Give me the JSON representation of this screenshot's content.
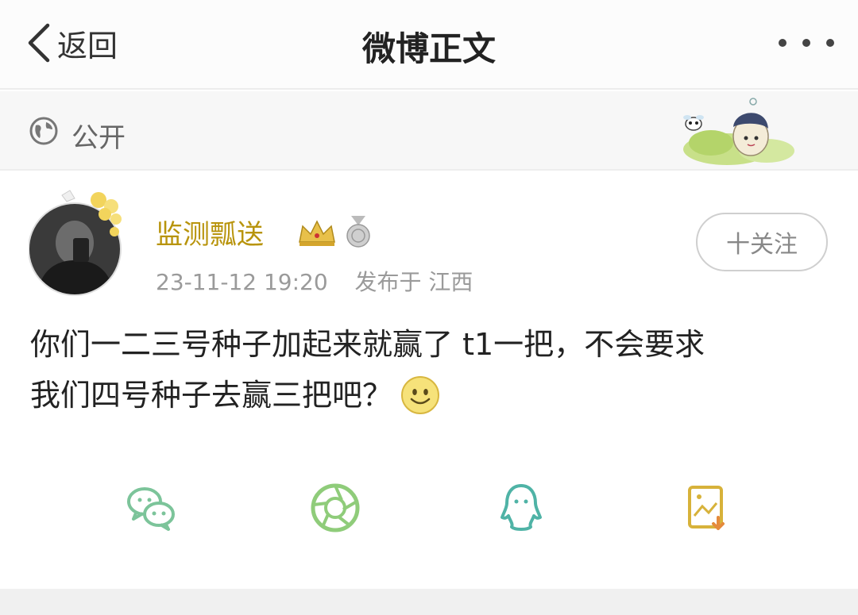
{
  "navbar": {
    "back_label": "返回",
    "title": "微博正文"
  },
  "privacy": {
    "label": "公开"
  },
  "post": {
    "author": "监测瓢送",
    "timestamp": "23-11-12 19:20",
    "source": "发布于 江西",
    "follow_label": "十关注",
    "content_line1": "你们一二三号种子加起来就赢了 t1一把，不会要求",
    "content_line2": "我们四号种子去赢三把吧？"
  },
  "share": {
    "items": [
      "wechat-icon",
      "moments-icon",
      "qq-icon",
      "save-image-icon"
    ]
  },
  "colors": {
    "username": "#b8940c",
    "share_green": "#7cc49a",
    "share_teal": "#4fb3a6",
    "share_gold": "#d7b23a"
  }
}
